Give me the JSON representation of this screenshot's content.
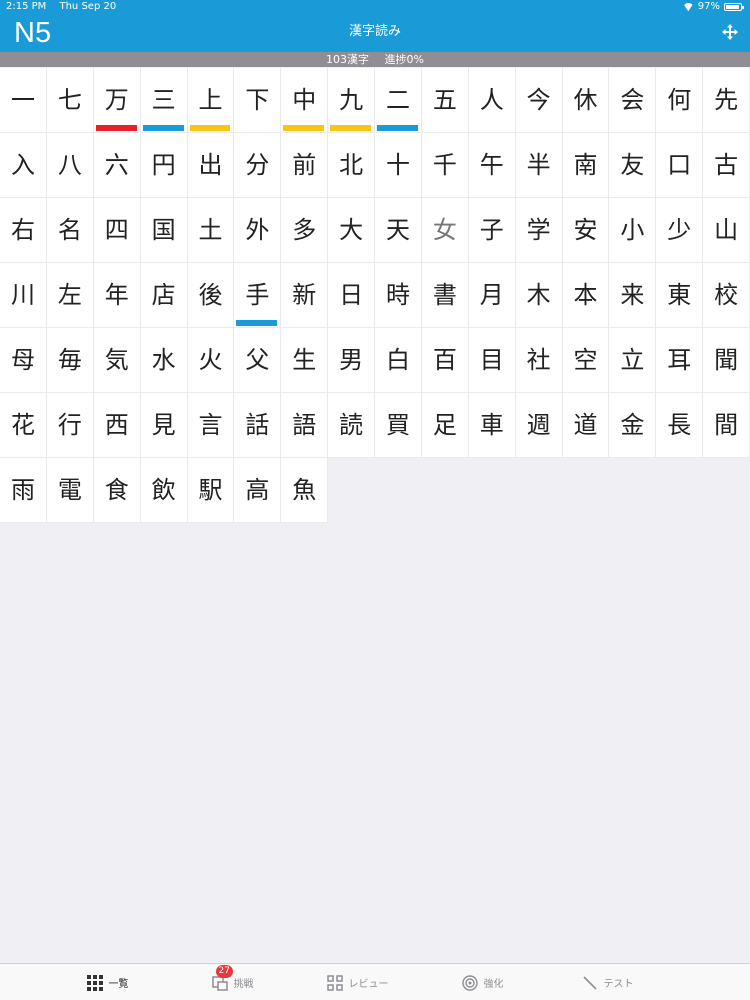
{
  "status_bar": {
    "time": "2:15 PM",
    "date": "Thu Sep 20",
    "battery": "97%"
  },
  "nav": {
    "level": "N5",
    "title": "漢字読み"
  },
  "progress": {
    "count_text": "103漢字",
    "progress_text": "進捗0%"
  },
  "colors": {
    "header": "#1a9bd7",
    "progress_bar": "#8e8e93",
    "mark_red": "#e8202a",
    "mark_blue": "#1a9bd7",
    "mark_yellow": "#f7c614",
    "badge": "#e8383c"
  },
  "kanji": [
    {
      "k": "一"
    },
    {
      "k": "七"
    },
    {
      "k": "万",
      "mark": "red"
    },
    {
      "k": "三",
      "mark": "blue"
    },
    {
      "k": "上",
      "mark": "yellow"
    },
    {
      "k": "下"
    },
    {
      "k": "中",
      "mark": "yellow"
    },
    {
      "k": "九",
      "mark": "yellow"
    },
    {
      "k": "二",
      "mark": "blue"
    },
    {
      "k": "五"
    },
    {
      "k": "人"
    },
    {
      "k": "今"
    },
    {
      "k": "休"
    },
    {
      "k": "会"
    },
    {
      "k": "何"
    },
    {
      "k": "先"
    },
    {
      "k": "入"
    },
    {
      "k": "八"
    },
    {
      "k": "六"
    },
    {
      "k": "円"
    },
    {
      "k": "出"
    },
    {
      "k": "分"
    },
    {
      "k": "前"
    },
    {
      "k": "北"
    },
    {
      "k": "十"
    },
    {
      "k": "千"
    },
    {
      "k": "午"
    },
    {
      "k": "半"
    },
    {
      "k": "南"
    },
    {
      "k": "友"
    },
    {
      "k": "口"
    },
    {
      "k": "古"
    },
    {
      "k": "右"
    },
    {
      "k": "名"
    },
    {
      "k": "四"
    },
    {
      "k": "国"
    },
    {
      "k": "土"
    },
    {
      "k": "外"
    },
    {
      "k": "多"
    },
    {
      "k": "大"
    },
    {
      "k": "天"
    },
    {
      "k": "女",
      "dim": true
    },
    {
      "k": "子"
    },
    {
      "k": "学"
    },
    {
      "k": "安"
    },
    {
      "k": "小"
    },
    {
      "k": "少"
    },
    {
      "k": "山"
    },
    {
      "k": "川"
    },
    {
      "k": "左"
    },
    {
      "k": "年"
    },
    {
      "k": "店"
    },
    {
      "k": "後"
    },
    {
      "k": "手",
      "mark": "blue"
    },
    {
      "k": "新"
    },
    {
      "k": "日"
    },
    {
      "k": "時"
    },
    {
      "k": "書"
    },
    {
      "k": "月"
    },
    {
      "k": "木"
    },
    {
      "k": "本"
    },
    {
      "k": "来"
    },
    {
      "k": "東"
    },
    {
      "k": "校"
    },
    {
      "k": "母"
    },
    {
      "k": "毎"
    },
    {
      "k": "気"
    },
    {
      "k": "水"
    },
    {
      "k": "火"
    },
    {
      "k": "父"
    },
    {
      "k": "生"
    },
    {
      "k": "男"
    },
    {
      "k": "白"
    },
    {
      "k": "百"
    },
    {
      "k": "目"
    },
    {
      "k": "社"
    },
    {
      "k": "空"
    },
    {
      "k": "立"
    },
    {
      "k": "耳"
    },
    {
      "k": "聞"
    },
    {
      "k": "花"
    },
    {
      "k": "行"
    },
    {
      "k": "西"
    },
    {
      "k": "見"
    },
    {
      "k": "言"
    },
    {
      "k": "話"
    },
    {
      "k": "語"
    },
    {
      "k": "読"
    },
    {
      "k": "買"
    },
    {
      "k": "足"
    },
    {
      "k": "車"
    },
    {
      "k": "週"
    },
    {
      "k": "道"
    },
    {
      "k": "金"
    },
    {
      "k": "長"
    },
    {
      "k": "間"
    },
    {
      "k": "雨"
    },
    {
      "k": "電"
    },
    {
      "k": "食"
    },
    {
      "k": "飲"
    },
    {
      "k": "駅"
    },
    {
      "k": "高"
    },
    {
      "k": "魚"
    }
  ],
  "tabs": [
    {
      "label": "一覧",
      "icon": "grid-icon",
      "active": true
    },
    {
      "label": "挑戦",
      "icon": "challenge-icon",
      "badge": "27"
    },
    {
      "label": "レビュー",
      "icon": "review-icon"
    },
    {
      "label": "強化",
      "icon": "target-icon"
    },
    {
      "label": "テスト",
      "icon": "pencil-icon"
    }
  ]
}
